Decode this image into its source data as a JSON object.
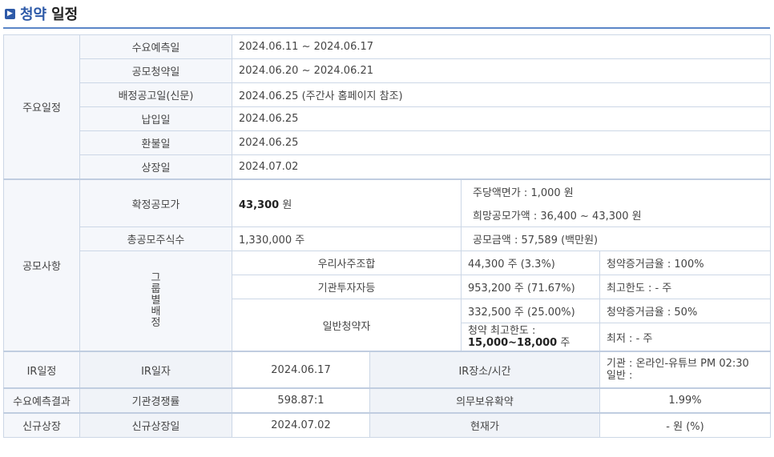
{
  "title": {
    "part1": "청약",
    "part2": "일정",
    "icon": "arrow-square-icon"
  },
  "schedule": {
    "group_label": "주요일정",
    "rows": [
      {
        "label": "수요예측일",
        "value": "2024.06.11  ~  2024.06.17"
      },
      {
        "label": "공모청약일",
        "value": "2024.06.20  ~  2024.06.21"
      },
      {
        "label": "배정공고일(신문)",
        "value": "2024.06.25 (주간사 홈페이지 참조)"
      },
      {
        "label": "납입일",
        "value": "2024.06.25"
      },
      {
        "label": "환불일",
        "value": "2024.06.25"
      },
      {
        "label": "상장일",
        "value": "2024.07.02"
      }
    ]
  },
  "offering": {
    "group_label": "공모사항",
    "confirmed_price_label": "확정공모가",
    "confirmed_price_value": "43,300",
    "confirmed_price_unit": "원",
    "par_value": "주당액면가 :  1,000 원",
    "desired_price": "희망공모가액 :  36,400 ~ 43,300 원",
    "total_shares_label": "총공모주식수",
    "total_shares_value": "1,330,000 주",
    "total_amount": "공모금액 : 57,589 (백만원)",
    "group_alloc_label": "그룹별배정",
    "groups": [
      {
        "name": "우리사주조합",
        "shares": "44,300 주  (3.3%)",
        "note": "청약증거금율 : 100%"
      },
      {
        "name": "기관투자자등",
        "shares": "953,200 주  (71.67%)",
        "note": "최고한도 :  - 주"
      },
      {
        "name": "일반청약자",
        "shares": "332,500 주  (25.00%)",
        "note": "청약증거금율 : 50%"
      }
    ],
    "max_limit_label": "청약 최고한도 :",
    "max_limit_value": "15,000~18,000",
    "max_limit_unit": "주",
    "min_note": "최저 :  - 주"
  },
  "ir": {
    "group_label": "IR일정",
    "date_label": "IR일자",
    "date_value": "2024.06.17",
    "place_label": "IR장소/시간",
    "place_line1": "기관 : 온라인-유튜브 PM 02:30",
    "place_line2": "일반 :"
  },
  "demand": {
    "group_label": "수요예측결과",
    "comp_label": "기관경쟁률",
    "comp_value": "598.87:1",
    "lockup_label": "의무보유확약",
    "lockup_value": "1.99%"
  },
  "listing": {
    "group_label": "신규상장",
    "date_label": "신규상장일",
    "date_value": "2024.07.02",
    "price_label": "현재가",
    "price_value": "- 원 (%)"
  }
}
